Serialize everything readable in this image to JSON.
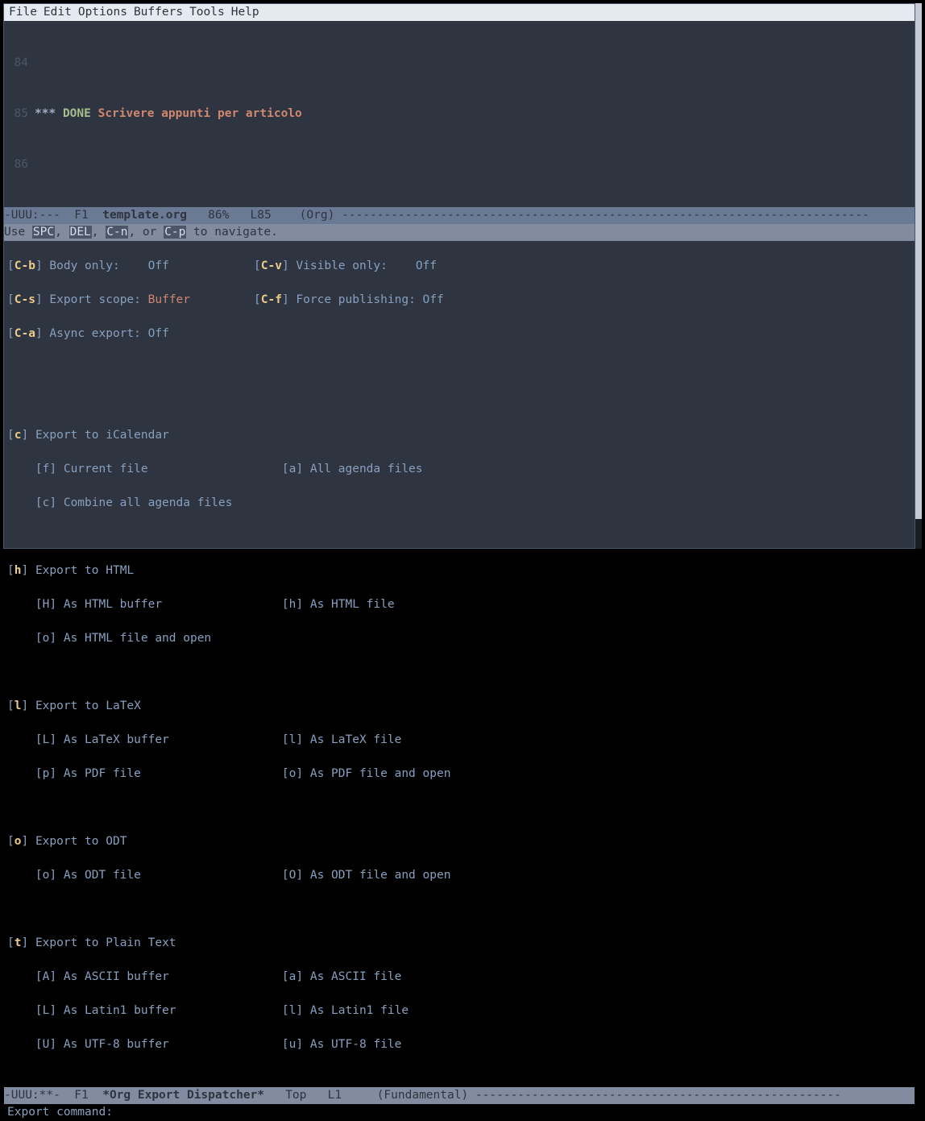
{
  "menu": {
    "file": "File",
    "edit": "Edit",
    "options": "Options",
    "buffers": "Buffers",
    "tools": "Tools",
    "help": "Help"
  },
  "buf": {
    "l84": "84",
    "l85": "85",
    "stars": "***",
    "done": "DONE",
    "heading": "Scrivere appunti per articolo",
    "l86": "86"
  },
  "modeline1": {
    "left": "-UUU:---  F1  ",
    "name": "template.org",
    "right": "   86%   L85    (Org) ",
    "dash": "---------------------------------------------------------------------------"
  },
  "helpline": {
    "pre": "Use ",
    "k1": "SPC",
    "sep1": ", ",
    "k2": "DEL",
    "sep2": ", ",
    "k3": "C-n",
    "sep3": ", or ",
    "k4": "C-p",
    "post": " to navigate."
  },
  "opts": {
    "cb": {
      "k": "C-b",
      "l": "Body only:    ",
      "v": "Off"
    },
    "cv": {
      "k": "C-v",
      "l": "Visible only:    ",
      "v": "Off"
    },
    "cs": {
      "k": "C-s",
      "l": "Export scope: ",
      "v": "Buffer"
    },
    "cf": {
      "k": "C-f",
      "l": "Force publishing: ",
      "v": "Off"
    },
    "ca": {
      "k": "C-a",
      "l": "Async export: ",
      "v": "Off"
    }
  },
  "groups": {
    "ical": {
      "k": "c",
      "t": "Export to iCalendar",
      "items": [
        {
          "a": "[f] Current file",
          "b": "[a] All agenda files"
        },
        {
          "a": "[c] Combine all agenda files",
          "b": ""
        }
      ]
    },
    "html": {
      "k": "h",
      "t": "Export to HTML",
      "items": [
        {
          "a": "[H] As HTML buffer",
          "b": "[h] As HTML file"
        },
        {
          "a": "[o] As HTML file and open",
          "b": ""
        }
      ]
    },
    "latex": {
      "k": "l",
      "t": "Export to LaTeX",
      "items": [
        {
          "a": "[L] As LaTeX buffer",
          "b": "[l] As LaTeX file"
        },
        {
          "a": "[p] As PDF file",
          "b": "[o] As PDF file and open"
        }
      ]
    },
    "odt": {
      "k": "o",
      "t": "Export to ODT",
      "items": [
        {
          "a": "[o] As ODT file",
          "b": "[O] As ODT file and open"
        }
      ]
    },
    "text": {
      "k": "t",
      "t": "Export to Plain Text",
      "items": [
        {
          "a": "[A] As ASCII buffer",
          "b": "[a] As ASCII file"
        },
        {
          "a": "[L] As Latin1 buffer",
          "b": "[l] As Latin1 file"
        },
        {
          "a": "[U] As UTF-8 buffer",
          "b": "[u] As UTF-8 file"
        }
      ]
    }
  },
  "modeline2": {
    "left": "-UUU:**-  F1  ",
    "name": "*Org Export Dispatcher*",
    "right": "   Top   L1     (Fundamental) ",
    "dash": "----------------------------------------------------"
  },
  "minibuf": "Export command:"
}
